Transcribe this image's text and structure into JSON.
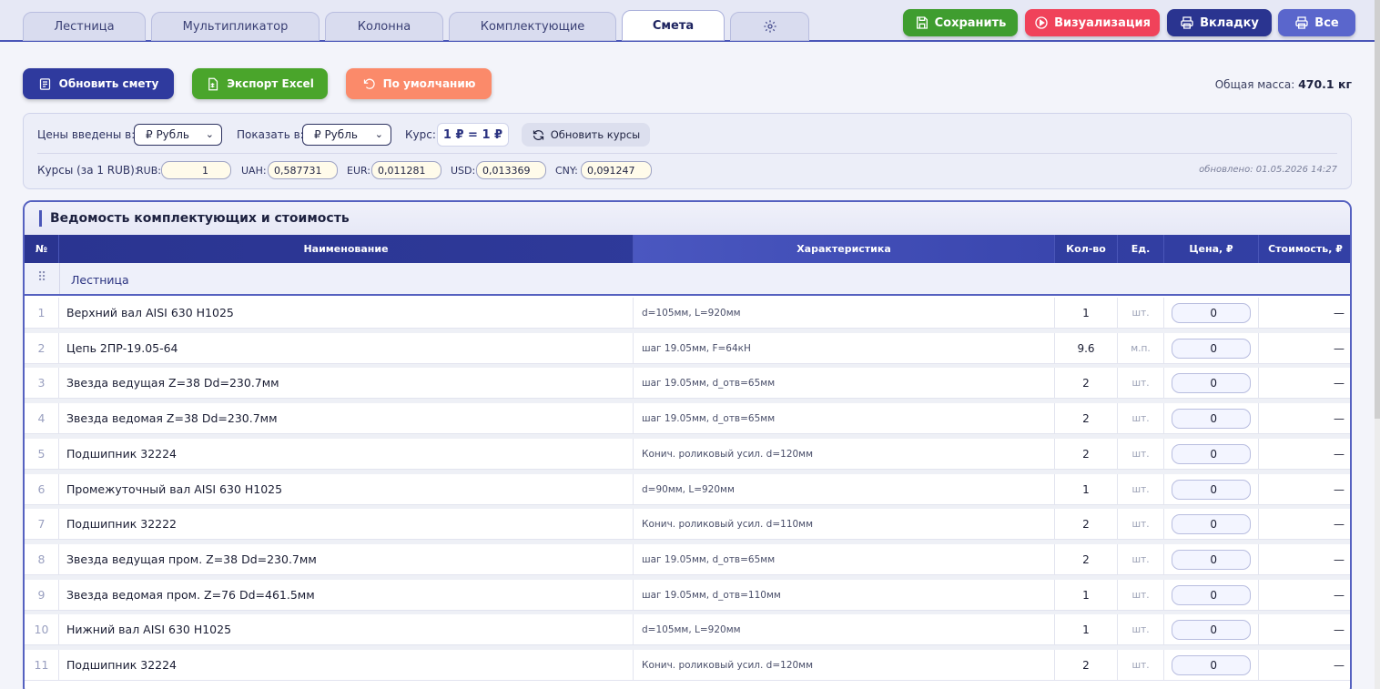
{
  "tabs": [
    {
      "label": "Лестница",
      "active": false
    },
    {
      "label": "Мультипликатор",
      "active": false
    },
    {
      "label": "Колонна",
      "active": false
    },
    {
      "label": "Комплектующие",
      "active": false
    },
    {
      "label": "Смета",
      "active": true
    },
    {
      "label": "",
      "icon": "gear-icon",
      "active": false
    }
  ],
  "toolbar": {
    "save": "Сохранить",
    "visualize": "Визуализация",
    "tab_print": "Вкладку",
    "all_print": "Все",
    "colors": {
      "save": "#3f9d2f",
      "visualize": "#f0425a",
      "tab_print": "#2a3490",
      "all_print": "#5a66cc"
    }
  },
  "actions": {
    "update": "Обновить смету",
    "export": "Экспорт Excel",
    "default": "По умолчанию",
    "colors": {
      "update": "#2f3a9e",
      "export": "#4aa52b",
      "default": "#fb8a6a"
    }
  },
  "mass": {
    "label": "Общая масса:",
    "value": "470.1 кг"
  },
  "currency": {
    "entered_label": "Цены введены в:",
    "entered_value": "₽ Рубль",
    "show_label": "Показать в:",
    "show_value": "₽ Рубль",
    "rate_label": "Курс:",
    "rate_value": "1 ₽ = 1 ₽",
    "refresh": "Обновить курсы",
    "rates_label": "Курсы (за 1 RUB):",
    "rates": [
      {
        "code": "RUB:",
        "value": "1"
      },
      {
        "code": "UAH:",
        "value": "0,587731"
      },
      {
        "code": "EUR:",
        "value": "0,011281"
      },
      {
        "code": "USD:",
        "value": "0,013369"
      },
      {
        "code": "CNY:",
        "value": "0,091247"
      }
    ],
    "updated": "обновлено: 01.05.2026 14:27"
  },
  "table": {
    "title": "Ведомость комплектующих и стоимость",
    "headers": {
      "num": "№",
      "name": "Наименование",
      "char": "Характеристика",
      "qty": "Кол-во",
      "unit": "Ед.",
      "price": "Цена, ₽",
      "cost": "Стоимость, ₽"
    },
    "group": "Лестница",
    "rows": [
      {
        "num": "1",
        "name": "Верхний вал AISI 630 H1025",
        "char": "d=105мм, L=920мм",
        "qty": "1",
        "unit": "шт.",
        "price": "0",
        "cost": "—"
      },
      {
        "num": "2",
        "name": "Цепь 2ПР-19.05-64",
        "char": "шаг 19.05мм, F=64кН",
        "qty": "9.6",
        "unit": "м.п.",
        "price": "0",
        "cost": "—"
      },
      {
        "num": "3",
        "name": "Звезда ведущая Z=38 Dd=230.7мм",
        "char": "шаг 19.05мм, d_отв=65мм",
        "qty": "2",
        "unit": "шт.",
        "price": "0",
        "cost": "—"
      },
      {
        "num": "4",
        "name": "Звезда ведомая Z=38 Dd=230.7мм",
        "char": "шаг 19.05мм, d_отв=65мм",
        "qty": "2",
        "unit": "шт.",
        "price": "0",
        "cost": "—"
      },
      {
        "num": "5",
        "name": "Подшипник 32224",
        "char": "Конич. роликовый усил. d=120мм",
        "qty": "2",
        "unit": "шт.",
        "price": "0",
        "cost": "—"
      },
      {
        "num": "6",
        "name": "Промежуточный вал AISI 630 H1025",
        "char": "d=90мм, L=920мм",
        "qty": "1",
        "unit": "шт.",
        "price": "0",
        "cost": "—"
      },
      {
        "num": "7",
        "name": "Подшипник 32222",
        "char": "Конич. роликовый усил. d=110мм",
        "qty": "2",
        "unit": "шт.",
        "price": "0",
        "cost": "—"
      },
      {
        "num": "8",
        "name": "Звезда ведущая пром. Z=38 Dd=230.7мм",
        "char": "шаг 19.05мм, d_отв=65мм",
        "qty": "2",
        "unit": "шт.",
        "price": "0",
        "cost": "—"
      },
      {
        "num": "9",
        "name": "Звезда ведомая пром. Z=76 Dd=461.5мм",
        "char": "шаг 19.05мм, d_отв=110мм",
        "qty": "1",
        "unit": "шт.",
        "price": "0",
        "cost": "—"
      },
      {
        "num": "10",
        "name": "Нижний вал AISI 630 H1025",
        "char": "d=105мм, L=920мм",
        "qty": "1",
        "unit": "шт.",
        "price": "0",
        "cost": "—"
      },
      {
        "num": "11",
        "name": "Подшипник 32224",
        "char": "Конич. роликовый усил. d=120мм",
        "qty": "2",
        "unit": "шт.",
        "price": "0",
        "cost": "—"
      }
    ]
  }
}
